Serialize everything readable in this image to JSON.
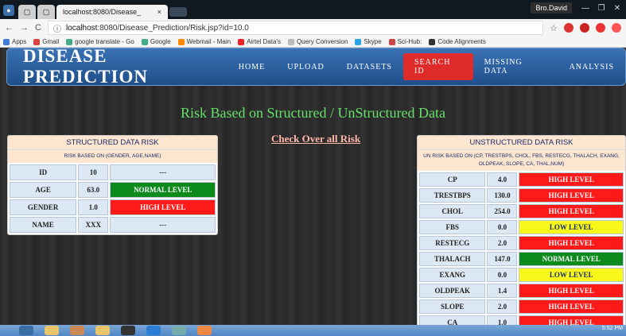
{
  "browser": {
    "tab_title": "localhost:8080/Disease_",
    "user": "Bro.David",
    "url_host": "localhost",
    "url_rest": ":8080/Disease_Prediction/Risk.jsp?id=10.0",
    "bookmarks": [
      "Apps",
      "Gmail",
      "google translate - Go",
      "Google",
      "Webmail - Main",
      "Airtel Data's",
      "Query Conversion",
      "Skype",
      "Sci-Hub:",
      "Code Alignments"
    ]
  },
  "nav": {
    "brand": "DISEASE PREDICTION",
    "items": [
      "HOME",
      "UPLOAD",
      "DATASETS",
      "SEARCH ID",
      "MISSING DATA",
      "ANALYSIS"
    ],
    "active": "SEARCH ID"
  },
  "heading": "Risk Based on Structured / UnStructured Data",
  "overall_link": "Check Over all Risk",
  "structured": {
    "title": "STRUCTURED DATA RISK",
    "subtitle": "RISK BASED ON (GENDER, AGE,NAME)",
    "rows": [
      {
        "label": "ID",
        "value": "10",
        "status": "---",
        "level": "NONE"
      },
      {
        "label": "AGE",
        "value": "63.0",
        "status": "NORMAL LEVEL",
        "level": "NORMAL"
      },
      {
        "label": "GENDER",
        "value": "1.0",
        "status": "HIGH LEVEL",
        "level": "HIGH"
      },
      {
        "label": "NAME",
        "value": "XXX",
        "status": "---",
        "level": "NONE"
      }
    ]
  },
  "unstructured": {
    "title": "UNSTRUCTURED DATA RISK",
    "subtitle": "UN RISK BASED ON (CP, TRESTBPS, CHOL, FBS, RESTECG, THALACH, EXANG, OLDPEAK, SLOPE, CA, THAL,NUM)",
    "rows": [
      {
        "label": "CP",
        "value": "4.0",
        "status": "HIGH LEVEL",
        "level": "HIGH"
      },
      {
        "label": "TRESTBPS",
        "value": "130.0",
        "status": "HIGH LEVEL",
        "level": "HIGH"
      },
      {
        "label": "CHOL",
        "value": "254.0",
        "status": "HIGH LEVEL",
        "level": "HIGH"
      },
      {
        "label": "FBS",
        "value": "0.0",
        "status": "LOW LEVEL",
        "level": "LOW"
      },
      {
        "label": "RESTECG",
        "value": "2.0",
        "status": "HIGH LEVEL",
        "level": "HIGH"
      },
      {
        "label": "THALACH",
        "value": "147.0",
        "status": "NORMAL LEVEL",
        "level": "NORMAL"
      },
      {
        "label": "EXANG",
        "value": "0.0",
        "status": "LOW LEVEL",
        "level": "LOW"
      },
      {
        "label": "OLDPEAK",
        "value": "1.4",
        "status": "HIGH LEVEL",
        "level": "HIGH"
      },
      {
        "label": "SLOPE",
        "value": "2.0",
        "status": "HIGH LEVEL",
        "level": "HIGH"
      },
      {
        "label": "CA",
        "value": "1.0",
        "status": "HIGH LEVEL",
        "level": "HIGH"
      }
    ]
  },
  "taskbar": {
    "clock": "5:52 PM"
  }
}
